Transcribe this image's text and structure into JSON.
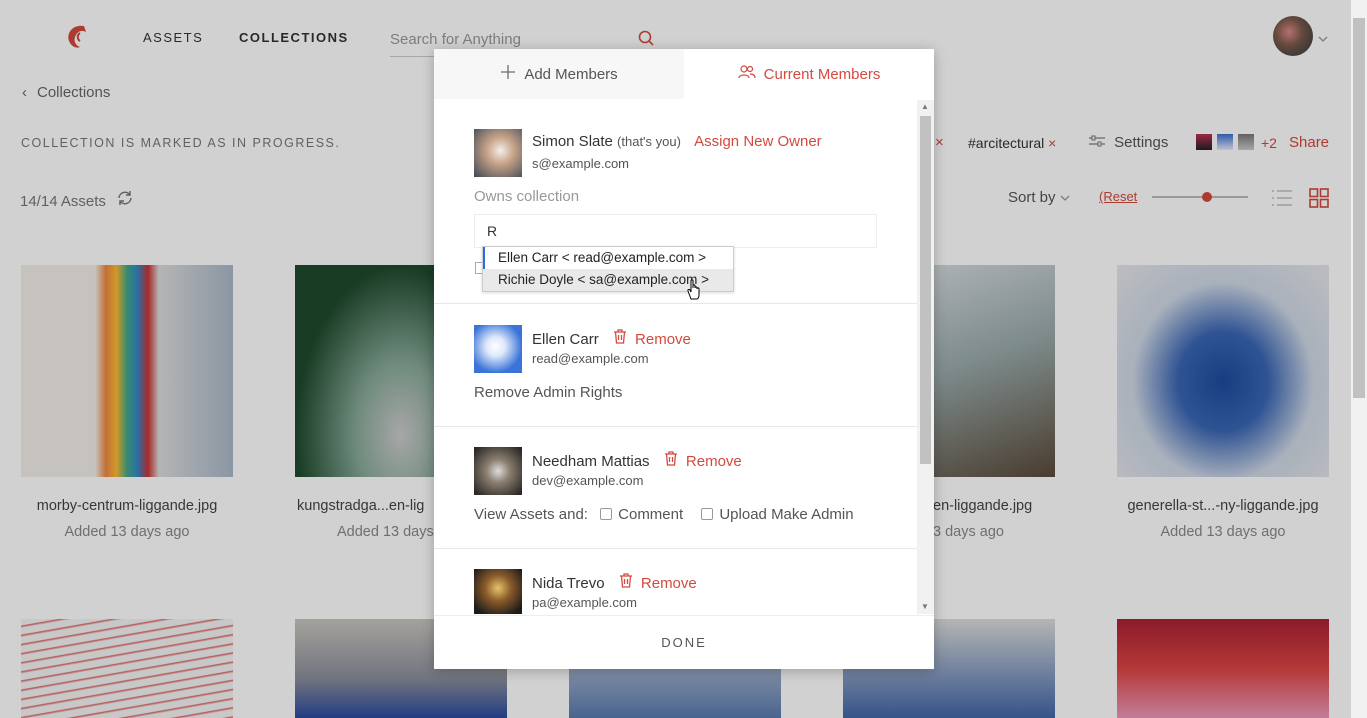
{
  "nav": {
    "assets": "ASSETS",
    "collections": "COLLECTIONS"
  },
  "search": {
    "placeholder": "Search for Anything"
  },
  "breadcrumb": {
    "label": "Collections"
  },
  "status": "COLLECTION IS MARKED AS IN PROGRESS.",
  "assets_count": "14/14 Assets",
  "tags": [
    {
      "label": "#arcitectural"
    }
  ],
  "toolbar": {
    "settings": "Settings",
    "more_count": "+2",
    "share": "Share",
    "sort_by": "Sort by",
    "reset": "(Reset"
  },
  "tiles": [
    {
      "name": "morby-centrum-liggande.jpg",
      "date": "Added 13 days ago"
    },
    {
      "name": "kungstradga...en-lig",
      "date": "Added 13 days"
    },
    {
      "name": "en-liggande.jpg",
      "date": "3 days ago"
    },
    {
      "name": "generella-st...-ny-liggande.jpg",
      "date": "Added 13 days ago"
    }
  ],
  "modal": {
    "tab_add": "Add Members",
    "tab_current": "Current Members",
    "done": "DONE",
    "owner": {
      "name": "Simon Slate",
      "you": "(that's you)",
      "action": "Assign New Owner",
      "email": "s@example.com",
      "role": "Owns collection",
      "input_value": "R"
    },
    "dropdown": [
      "Ellen Carr < read@example.com >",
      "Richie Doyle < sa@example.com >"
    ],
    "members": [
      {
        "name": "Ellen Carr",
        "action": "Remove",
        "email": "read@example.com",
        "extra": "Remove Admin Rights"
      },
      {
        "name": "Needham Mattias",
        "action": "Remove",
        "email": "dev@example.com",
        "view_label": "View Assets and:",
        "comment": "Comment",
        "upload": "Upload",
        "make_admin": "Make Admin"
      },
      {
        "name": "Nida Trevo",
        "action": "Remove",
        "email": "pa@example.com"
      }
    ]
  },
  "colors": {
    "accent": "#d4493e",
    "selection": "#2d6cdf"
  }
}
